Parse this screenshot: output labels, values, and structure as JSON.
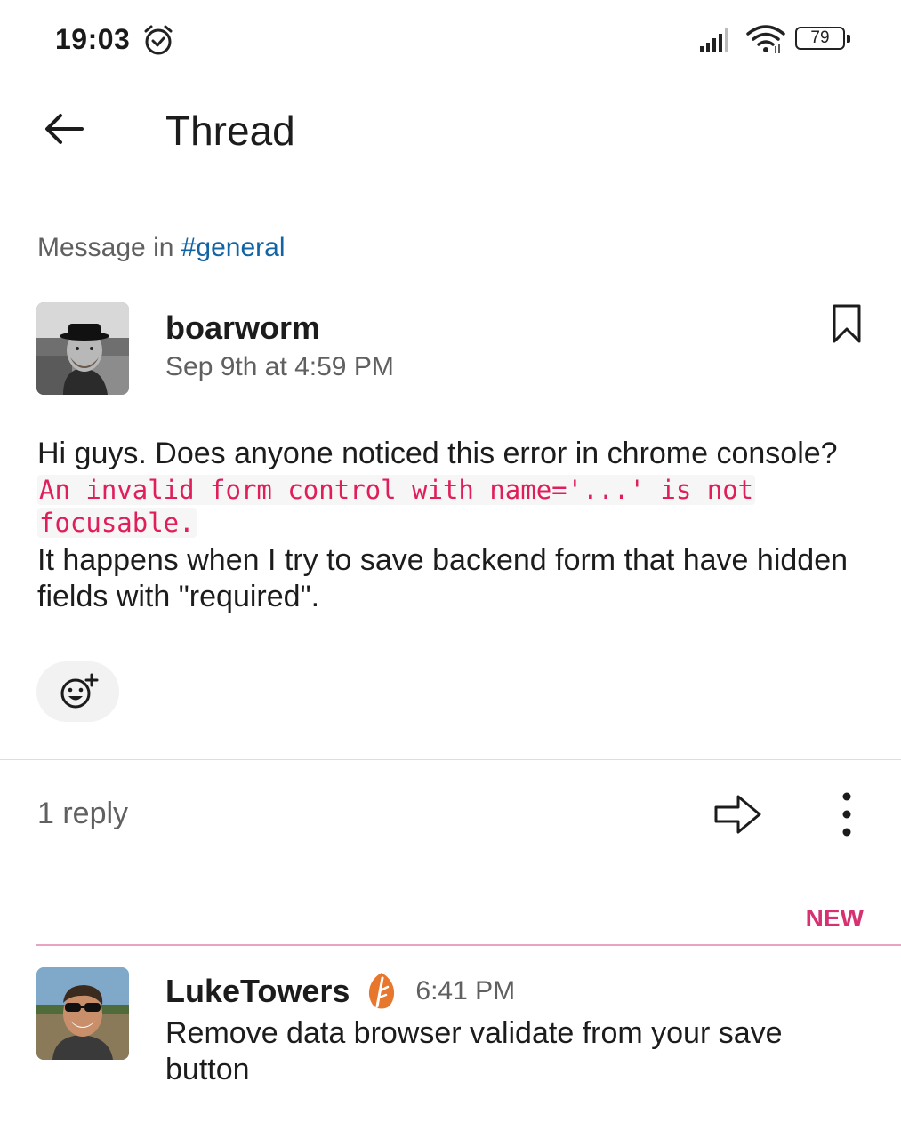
{
  "status_bar": {
    "time": "19:03",
    "battery": "79"
  },
  "header": {
    "title": "Thread"
  },
  "context": {
    "prefix": "Message in ",
    "channel": "#general"
  },
  "parent_message": {
    "author": "boarworm",
    "timestamp": "Sep 9th at 4:59 PM",
    "text_line1": "Hi guys. Does anyone noticed this error in chrome console?",
    "code": "An invalid form control with name='...' is not focusable.",
    "text_line2": "It happens when I try to save backend form that have hidden fields with \"required\"."
  },
  "thread_bar": {
    "reply_count": "1 reply"
  },
  "new_marker": "NEW",
  "reply": {
    "author": "LukeTowers",
    "time": "6:41 PM",
    "text": "Remove data browser validate from your save button"
  },
  "colors": {
    "link": "#1264a3",
    "code_text": "#e01e5a",
    "new_marker": "#d63271",
    "badge": "#e8772e"
  }
}
